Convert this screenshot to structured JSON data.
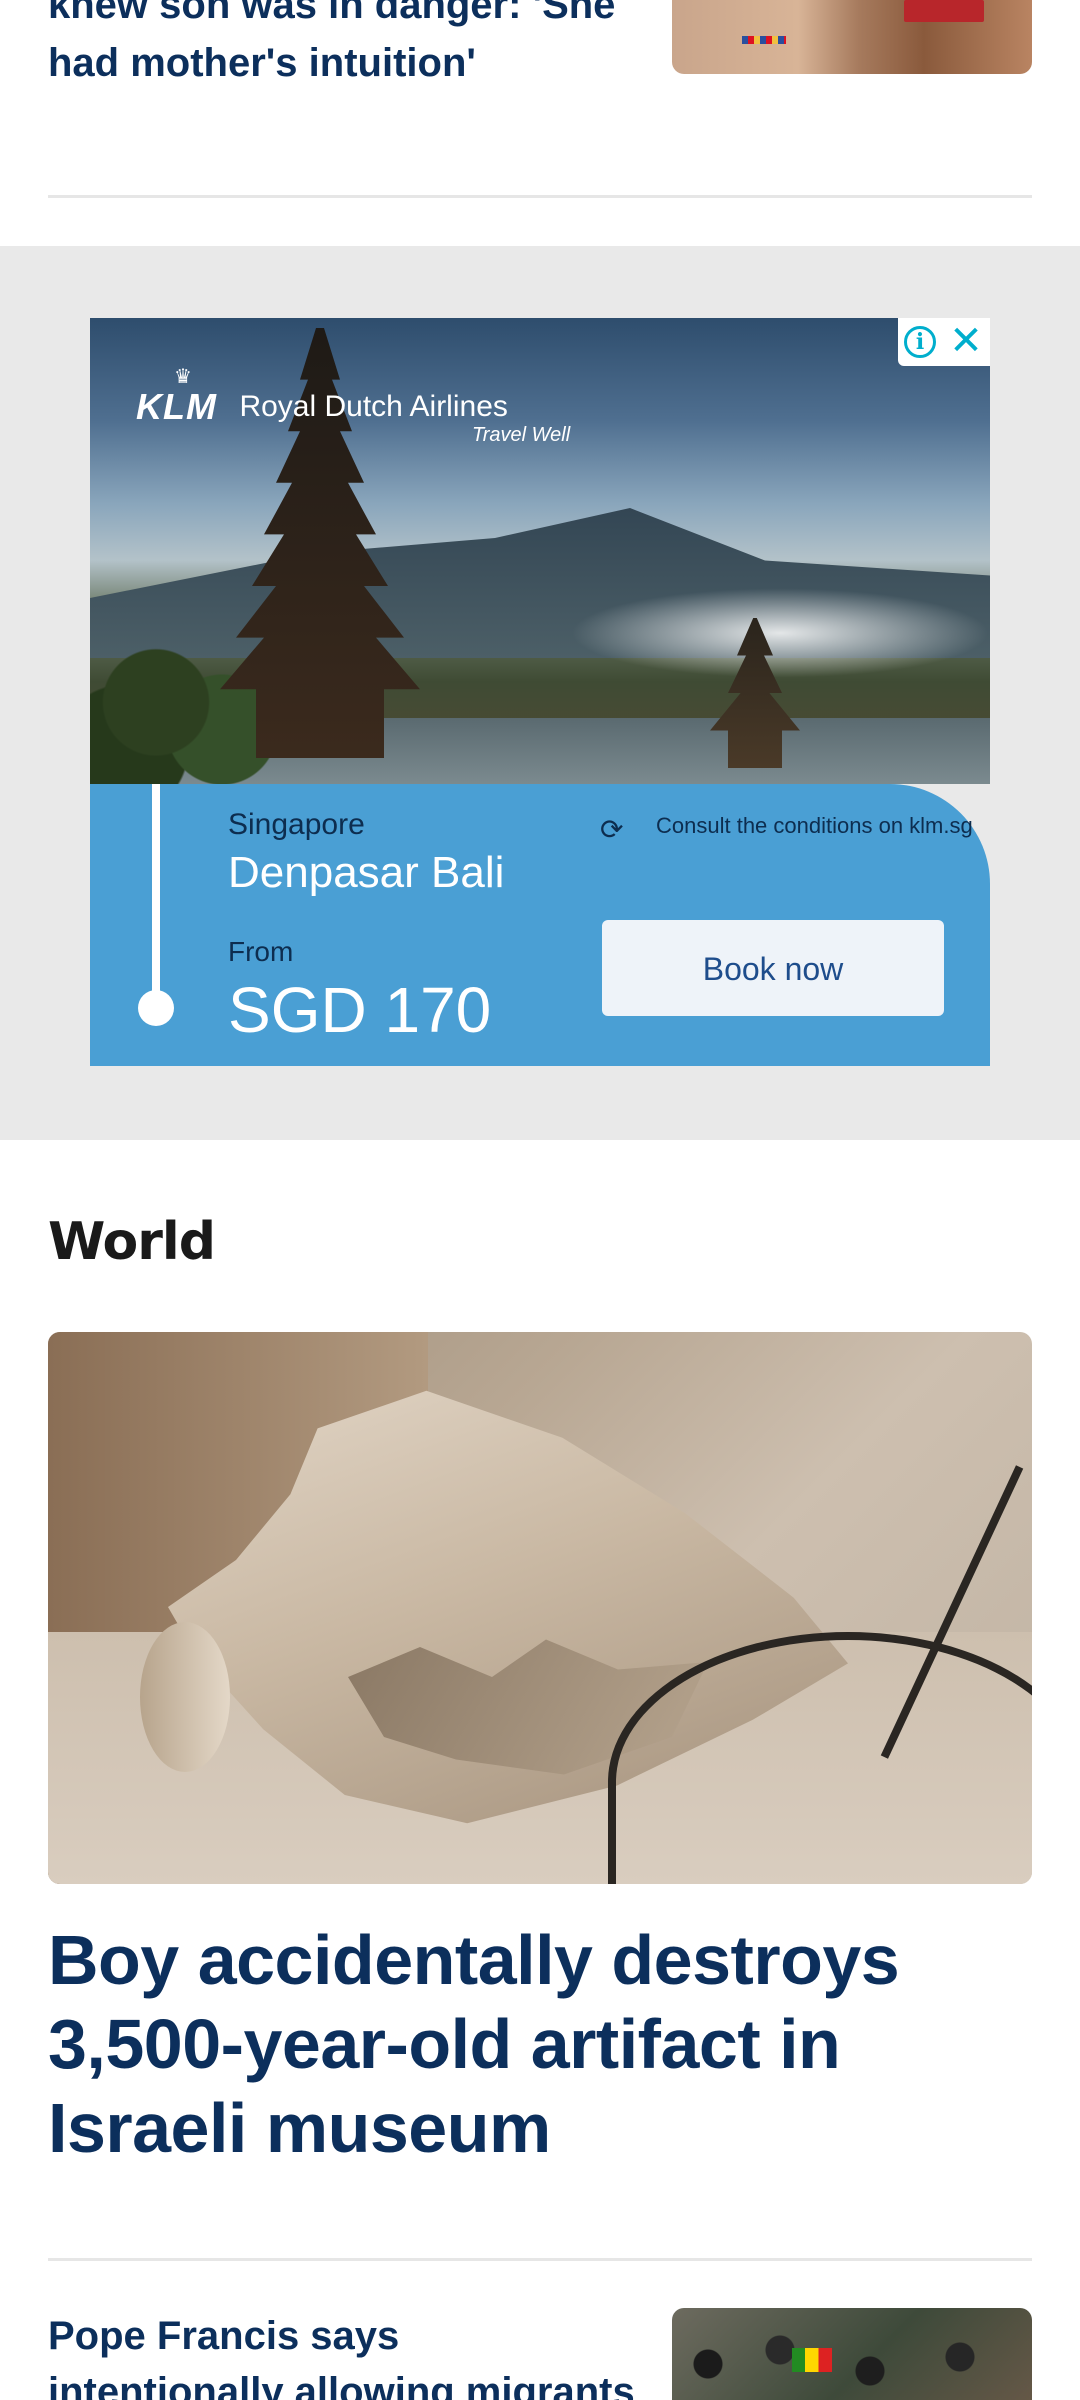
{
  "top_story": {
    "headline": "knew son was in danger: 'She had mother's intuition'"
  },
  "ad": {
    "brand": "KLM",
    "airline": "Royal Dutch Airlines",
    "tagline": "Travel Well",
    "origin": "Singapore",
    "destination": "Denpasar Bali",
    "from_label": "From",
    "price": "SGD 170",
    "conditions": "Consult the conditions on klm.sg",
    "cta": "Book now",
    "info_icon": "info-icon",
    "close_icon": "close-icon"
  },
  "section": {
    "title": "World"
  },
  "hero_story": {
    "headline": "Boy accidentally destroys 3,500-year-old artifact in Israeli museum"
  },
  "next_story": {
    "headline": "Pope Francis says intentionally allowing migrants to die is a"
  },
  "colors": {
    "headline": "#0c2f5c",
    "ad_panel": "#4a9fd4",
    "ad_accent": "#00aecd",
    "ad_background": "#e9e9e9"
  }
}
